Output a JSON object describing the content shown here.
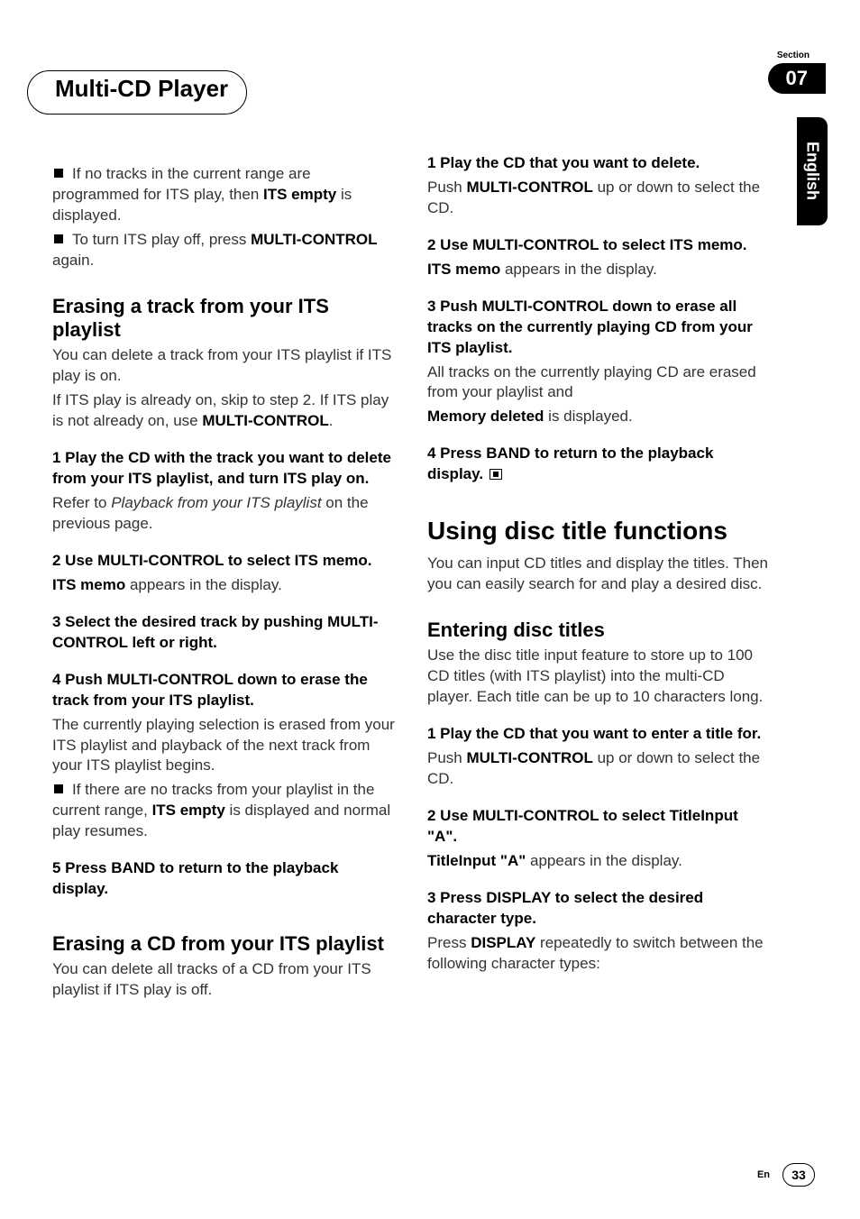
{
  "header": {
    "title": "Multi-CD Player",
    "section_label": "Section",
    "section_number": "07"
  },
  "tab": {
    "language": "English"
  },
  "footer": {
    "lang": "En",
    "page": "33"
  },
  "left": {
    "intro_bullet_pre": "If no tracks in the current range are programmed for ITS play, then ",
    "its_empty": "ITS empty",
    "intro_bullet_post": " is displayed.",
    "turnoff_pre": "To turn ITS play off, press ",
    "multicontrol": "MULTI-CONTROL",
    "turnoff_post": " again.",
    "h2a": "Erasing a track from your ITS playlist",
    "p1": "You can delete a track from your ITS playlist if ITS play is on.",
    "p2_pre": "If ITS play is already on, skip to step 2. If ITS play is not already on, use ",
    "p2_post": ".",
    "s1": "1    Play the CD with the track you want to delete from your ITS playlist, and turn ITS play on.",
    "s1_ref_pre": "Refer to ",
    "s1_ref_i": "Playback from your ITS playlist",
    "s1_ref_post": " on the previous page.",
    "s2": "2    Use MULTI-CONTROL to select ITS memo.",
    "s2_body_b": "ITS memo",
    "s2_body_post": " appears in the display.",
    "s3": "3    Select the desired track by pushing MULTI-CONTROL left or right.",
    "s4": "4    Push MULTI-CONTROL down to erase the track from your ITS playlist.",
    "s4_body": "The currently playing selection is erased from your ITS playlist and playback of the next track from your ITS playlist begins.",
    "s4_bullet_pre": "If there are no tracks from your playlist in the current range, ",
    "s4_bullet_post": " is displayed and normal play resumes.",
    "s5": "5    Press BAND to return to the playback display.",
    "h2b": "Erasing a CD from your ITS playlist",
    "p3": "You can delete all tracks of a CD from your ITS playlist if ITS play is off."
  },
  "right": {
    "s1": "1    Play the CD that you want to delete.",
    "s1_body_pre": "Push ",
    "s1_body_post": " up or down to select the CD.",
    "s2": "2    Use MULTI-CONTROL to select ITS memo.",
    "s2_body_b": "ITS memo",
    "s2_body_post": " appears in the display.",
    "s3": "3    Push MULTI-CONTROL down to erase all tracks on the currently playing CD from your ITS playlist.",
    "s3_body": "All tracks on the currently playing CD are erased from your playlist and",
    "s3_body_b": "Memory deleted",
    "s3_body_post": " is displayed.",
    "s4": "4    Press BAND to return to the playback display.",
    "h1": "Using disc title functions",
    "h1_body": "You can input CD titles and display the titles. Then you can easily search for and play a desired disc.",
    "h2": "Entering disc titles",
    "h2_body": "Use the disc title input feature to store up to 100 CD titles  (with ITS playlist) into the multi-CD player. Each title can be up to 10 characters long.",
    "e_s1": "1    Play the CD that you want to enter a title for.",
    "e_s1_body_pre": "Push ",
    "e_s1_body_post": " up or down to select the CD.",
    "e_s2": "2    Use MULTI-CONTROL to select TitleInput  \"A\".",
    "e_s2_body_b": "TitleInput  \"A\"",
    "e_s2_body_post": " appears in the display.",
    "e_s3": "3    Press DISPLAY to select the desired character type.",
    "e_s3_body_pre": "Press ",
    "e_s3_body_b": "DISPLAY",
    "e_s3_body_post": " repeatedly to switch between the following character types:"
  }
}
